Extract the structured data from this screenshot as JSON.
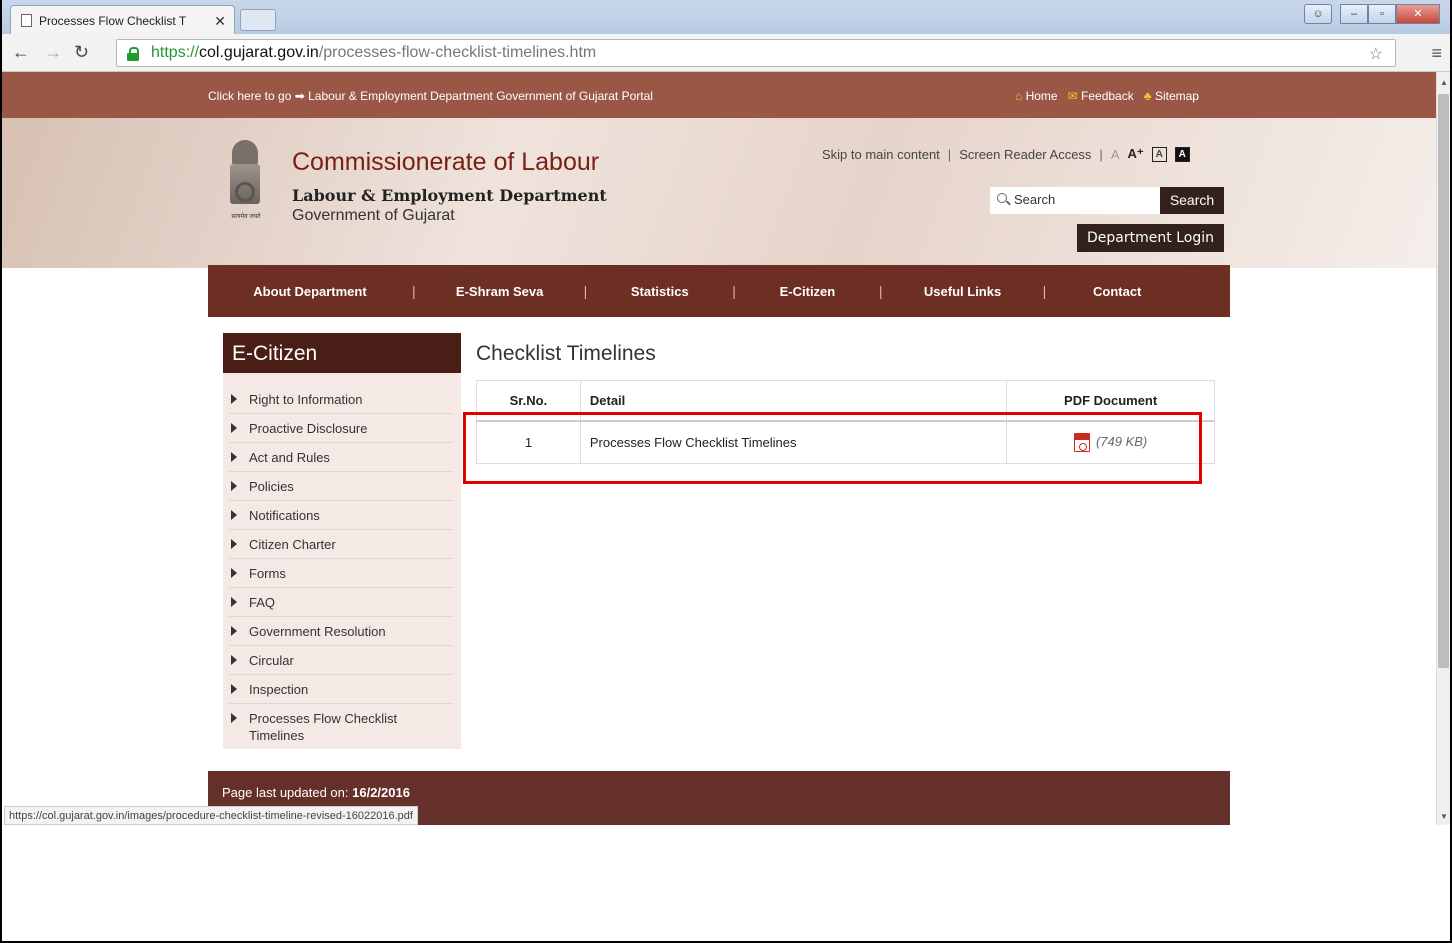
{
  "browser": {
    "tab_title": "Processes Flow Checklist T",
    "url_scheme": "https://",
    "url_host": "col.gujarat.gov.in",
    "url_path": "/processes-flow-checklist-timelines.htm",
    "status_url": "https://col.gujarat.gov.in/images/procedure-checklist-timeline-revised-16022016.pdf"
  },
  "topbar": {
    "goto_text": "Click here to go",
    "portal_link": "Labour & Employment Department Government of Gujarat Portal",
    "home": "Home",
    "feedback": "Feedback",
    "sitemap": "Sitemap"
  },
  "header": {
    "title": "Commissionerate of Labour",
    "sub1": "Labour & Employment Department",
    "sub2": "Government of Gujarat",
    "emblem_motto": "सत्यमेव जयते",
    "skip": "Skip to main content",
    "screen_reader": "Screen Reader Access",
    "font_small": "A",
    "font_big": "A⁺",
    "contrast_light": "A",
    "contrast_dark": "A",
    "search_placeholder": "Search",
    "search_button": "Search",
    "login_button": "Department Login"
  },
  "nav": [
    "About Department",
    "E-Shram Seva",
    "Statistics",
    "E-Citizen",
    "Useful Links",
    "Contact"
  ],
  "sidebar": {
    "title": "E-Citizen",
    "items": [
      "Right to Information",
      "Proactive Disclosure",
      "Act and Rules",
      "Policies",
      "Notifications",
      "Citizen Charter",
      "Forms",
      "FAQ",
      "Government Resolution",
      "Circular",
      "Inspection",
      "Processes Flow Checklist Timelines"
    ]
  },
  "main": {
    "heading": "Checklist Timelines",
    "columns": [
      "Sr.No.",
      "Detail",
      "PDF Document"
    ],
    "rows": [
      {
        "sr": "1",
        "detail": "Processes Flow Checklist Timelines",
        "size": "(749 KB)"
      }
    ]
  },
  "footer": {
    "label": "Page last updated on:",
    "date": "16/2/2016"
  },
  "colors": {
    "brand_brown": "#6d2e24",
    "highlight": "#e00000"
  }
}
